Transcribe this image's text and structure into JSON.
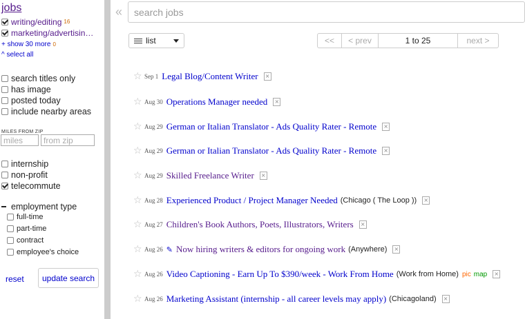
{
  "sidebar": {
    "category_title": "jobs",
    "categories": [
      {
        "label": "writing/editing",
        "count": "16",
        "checked": true
      },
      {
        "label": "marketing/advertisin…",
        "count": "",
        "checked": true
      }
    ],
    "show_more": "+ show 30 more",
    "show_more_count": "0",
    "select_all": "^ select all",
    "options": [
      {
        "label": "search titles only",
        "checked": false
      },
      {
        "label": "has image",
        "checked": false
      },
      {
        "label": "posted today",
        "checked": false
      },
      {
        "label": "include nearby areas",
        "checked": false
      }
    ],
    "miles_from_zip_label": "MILES FROM ZIP",
    "miles_placeholder": "miles",
    "zip_placeholder": "from zip",
    "job_types": [
      {
        "label": "internship",
        "checked": false
      },
      {
        "label": "non-profit",
        "checked": false
      },
      {
        "label": "telecommute",
        "checked": true
      }
    ],
    "employment_type_label": "employment type",
    "employment_types": [
      {
        "label": "full-time",
        "checked": false
      },
      {
        "label": "part-time",
        "checked": false
      },
      {
        "label": "contract",
        "checked": false
      },
      {
        "label": "employee's choice",
        "checked": false
      }
    ],
    "reset_label": "reset",
    "update_label": "update search"
  },
  "header": {
    "collapse_glyph": "«",
    "search_placeholder": "search jobs"
  },
  "toolbar": {
    "view_mode": "list",
    "pager": {
      "first": "<<",
      "prev": "< prev",
      "range": "1 to 25",
      "next": "next >"
    }
  },
  "results": [
    {
      "date": "Sep 1",
      "title": "Legal Blog/Content Writer",
      "hood": "",
      "pic": "",
      "map": "",
      "visited": false
    },
    {
      "date": "Aug 30",
      "title": "Operations Manager needed",
      "hood": "",
      "pic": "",
      "map": "",
      "visited": false
    },
    {
      "date": "Aug 29",
      "title": "German or Italian Translator - Ads Quality Rater - Remote",
      "hood": "",
      "pic": "",
      "map": "",
      "visited": false
    },
    {
      "date": "Aug 29",
      "title": "German or Italian Translator - Ads Quality Rater - Remote",
      "hood": "",
      "pic": "",
      "map": "",
      "visited": false
    },
    {
      "date": "Aug 29",
      "title": "Skilled Freelance Writer",
      "hood": "",
      "pic": "",
      "map": "",
      "visited": true
    },
    {
      "date": "Aug 28",
      "title": "Experienced Product / Project Manager Needed",
      "hood": "(Chicago ( The Loop ))",
      "pic": "",
      "map": "",
      "visited": false
    },
    {
      "date": "Aug 27",
      "title": "Children's Book Authors, Poets, Illustrators, Writers",
      "hood": "",
      "pic": "",
      "map": "",
      "visited": true
    },
    {
      "date": "Aug 26",
      "title": "Now hiring writers & editors for ongoing work",
      "hood": "(Anywhere)",
      "pic": "",
      "map": "",
      "visited": true,
      "pencil": true
    },
    {
      "date": "Aug 26",
      "title": "Video Captioning - Earn Up To $390/week - Work From Home",
      "hood": "(Work from Home)",
      "pic": "pic",
      "map": "map",
      "visited": false
    },
    {
      "date": "Aug 26",
      "title": "Marketing Assistant (internship - all career levels may apply)",
      "hood": "(Chicagoland)",
      "pic": "",
      "map": "",
      "visited": false
    }
  ]
}
